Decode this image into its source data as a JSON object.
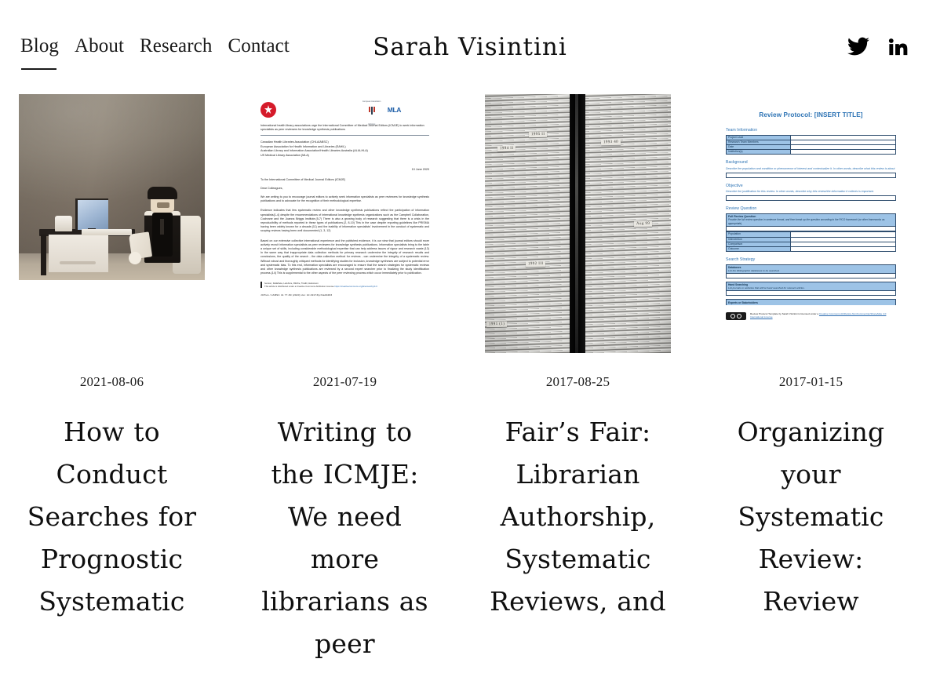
{
  "header": {
    "site_title": "Sarah Visintini",
    "nav": [
      {
        "label": "Blog",
        "active": true
      },
      {
        "label": "About",
        "active": false
      },
      {
        "label": "Research",
        "active": false
      },
      {
        "label": "Contact",
        "active": false
      }
    ],
    "social": [
      {
        "name": "twitter-icon",
        "label": "Twitter"
      },
      {
        "name": "linkedin-icon",
        "label": "LinkedIn"
      }
    ]
  },
  "posts": [
    {
      "date": "2021-08-06",
      "title": "How to Conduct Searches for Prognostic Systematic",
      "thumbnail": "lego-figure-at-desk-photo"
    },
    {
      "date": "2021-07-19",
      "title": "Writing to the ICMJE: We need more librarians as peer",
      "thumbnail": "icmje-letter-document"
    },
    {
      "date": "2017-08-25",
      "title": "Fair’s Fair: Librarian Authorship, Systematic Reviews, and",
      "thumbnail": "stacked-paper-files-photo"
    },
    {
      "date": "2017-01-15",
      "title": "Organizing your Systematic Review: Review",
      "thumbnail": "review-protocol-template-document"
    }
  ],
  "thumb_letter": {
    "logos": {
      "chla": "CHLA/ABSC",
      "eahil": "European Association for Health Information and Libraries",
      "mla": "MLA",
      "mla_sub": "Medical Library Association"
    },
    "headline": "International health library associations urge the International Committee of Medical Journal Editors (ICMJE) to seek information specialists as peer reviewers for knowledge synthesis publications",
    "orgs": "Canadian Health Libraries Association (CHLA/ABSC)\nEuropean Association for Health Information and Libraries (EAHIL)\nAustralian Library and Information Association/Health Libraries Australia (ALIA-HLA)\nUS Medical Library Association (MLA)",
    "date": "10 June 2020",
    "to": "To the International Committee of Medical Journal Editors (ICMJE)",
    "salutation": "Dear Colleagues,",
    "p1": "We are writing to you to encourage journal editors to actively seek information specialists as peer reviewers for knowledge synthesis publications and to advocate for the recognition of their methodological expertise.",
    "p2": "Evidence indicates that few systematic review and other knowledge synthesis publications reflect the participation of information specialists(1-4) despite the recommendations of international knowledge synthesis organizations such as the Campbell Collaboration, Cochrane and the Joanna Briggs Institute.(5-7) There is also a growing body of research suggesting that there is a crisis in the reproducibility of methods reported in these types of publications.(2, 8-10) This in the case despite reporting guidelines like PRISMA having been widely known for a decade.(11) and the inability of information specialists' involvement in the conduct of systematic and scoping reviews having been well documented.(1, 3, 12)",
    "p3": "Based on our extensive collective international experience and the published evidence, it is our view that journal editors should more actively recruit information specialists as peer reviewers for knowledge synthesis publications. Information specialists bring to the table a unique set of skills, including considerable methodological expertise that can help address issues of rigour and research waste.(13) In the same way that inappropriate data collection methods for primary research undermine the integrity of research results and conclusions, the quality of the search - the data collection method for reviews - can undermine the integrity of a systematic review. Without robust and thoroughly critiqued methods for identifying studies for inclusion, knowledge syntheses are subject to potential error and systematic bias. To this end, information specialists are encouraged to ensure that the search strategies for systematic reviews and other knowledge synthesis publications are reviewed by a second expert searcher prior to finalizing the study identification process.(14) This is supplemental to the other aspects of the peer reviewing process which occur immediately prior to publication.",
    "footer_authors": "Iverson, DellaSeta, Lefebvre, Ritchie, Traditi, Halvorson",
    "footer_license": "This article is distributed under a Creative Commons Attribution License",
    "footer_link": "https://creativecommons.org/licenses/by/4.0",
    "citation": "JCHLA / JABSC 41 77-80 (2020) doi: 10.29173/jchla29483"
  },
  "thumb_protocol": {
    "title": "Review Protocol: [INSERT TITLE]",
    "sections": [
      {
        "heading": "Team Information",
        "rows": [
          "Project Lead",
          "Research Team Members",
          "Date",
          "Institution(s)"
        ]
      },
      {
        "heading": "Background",
        "instruction": "Describe the population and condition or phenomenon of interest and contextualize it. In other words, describe what this review is about."
      },
      {
        "heading": "Objective",
        "instruction": "Describe the justification for this review. In other words, describe why this review/the information it collects is important."
      },
      {
        "heading": "Review Question",
        "band_title": "Full Review Question",
        "band_instruction": "Provide the full review question in sentence format, and then break up the question according to the PICO framework (or other frameworks as appropriate).",
        "rows": [
          "Population",
          "Intervention",
          "Comparison",
          "Outcome"
        ]
      },
      {
        "heading": "Search Strategy",
        "bands": [
          {
            "title": "Databases",
            "instruction": "List the bibliographic databases to be searched."
          },
          {
            "title": "Hand Searching",
            "instruction": "List journals or websites that will be hand searched for relevant articles."
          },
          {
            "title": "Experts or Stakeholders",
            "instruction": ""
          }
        ]
      }
    ],
    "license_text": "Review Protocol Template by Sarah Visintini is licensed under a",
    "license_link": "Creative Commons Attribution-NonCommercial-ShareAlike 4.0 International License"
  },
  "thumb_files": {
    "labels": [
      "1995 II",
      "1994 II",
      "1992 III",
      "1991 (1)",
      "Aug 99",
      "1993 40"
    ]
  }
}
